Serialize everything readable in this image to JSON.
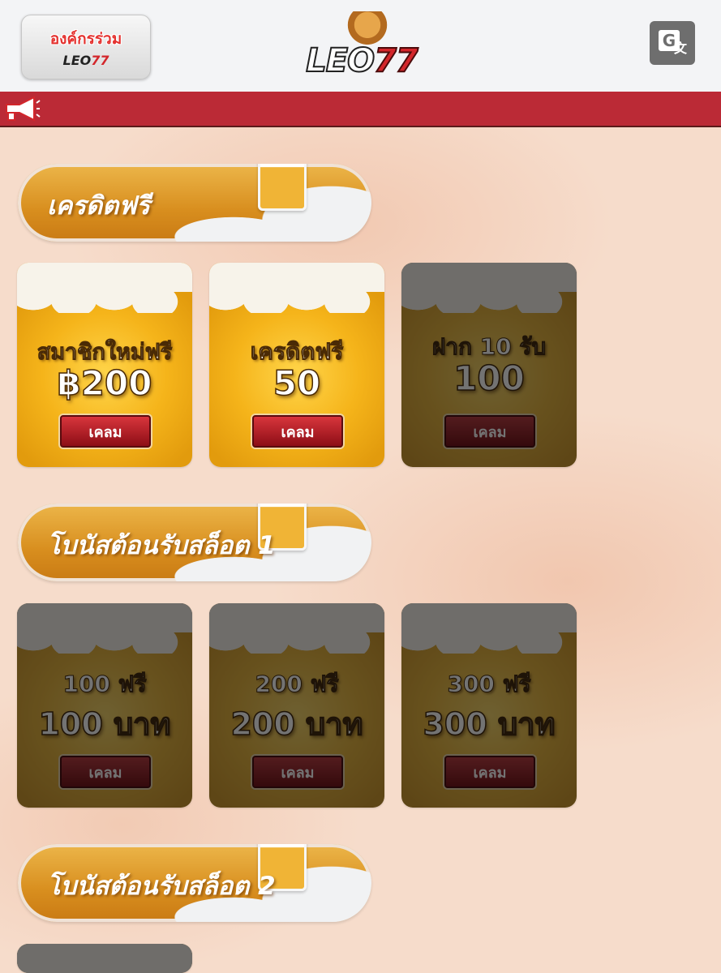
{
  "header": {
    "partner_button": {
      "title": "องค์กรร่วม",
      "logo_text": "LEO",
      "logo_num": "77"
    },
    "logo": {
      "text": "LEO",
      "num": "77"
    },
    "translate_icon": "google-translate-icon"
  },
  "announcement": {
    "icon": "megaphone-icon"
  },
  "sections": [
    {
      "title": "เครดิตฟรี",
      "cards": [
        {
          "line1": "สมาชิกใหม่ฟรี",
          "line2": "฿200",
          "button": "เคลม",
          "dim": false
        },
        {
          "line1": "เครดิตฟรี",
          "line2": "50",
          "button": "เคลม",
          "dim": false
        },
        {
          "line1": "ฝาก 10 รับ",
          "line2": "100",
          "button": "เคลม",
          "dim": true
        }
      ]
    },
    {
      "title": "โบนัสต้อนรับสล็อต 1",
      "cards": [
        {
          "line1": "100 ฟรี",
          "line2": "100 บาท",
          "button": "เคลม",
          "dim": true
        },
        {
          "line1": "200 ฟรี",
          "line2": "200 บาท",
          "button": "เคลม",
          "dim": true
        },
        {
          "line1": "300 ฟรี",
          "line2": "300 บาท",
          "button": "เคลม",
          "dim": true
        }
      ]
    },
    {
      "title": "โบนัสต้อนรับสล็อต 2",
      "cards": []
    }
  ],
  "colors": {
    "brand_red": "#bb2a36",
    "page_bg": "#f6dccb",
    "beer_gold": "#f5b41a"
  }
}
